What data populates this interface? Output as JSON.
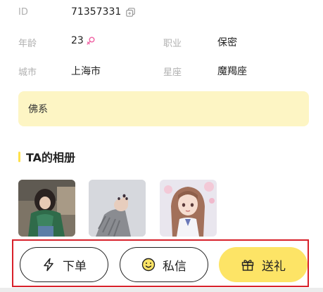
{
  "profile": {
    "id_label": "ID",
    "id_value": "71357331",
    "age_label": "年龄",
    "age_value": "23",
    "job_label": "职业",
    "job_value": "保密",
    "city_label": "城市",
    "city_value": "上海市",
    "zodiac_label": "星座",
    "zodiac_value": "魔羯座",
    "bio": "佛系"
  },
  "album": {
    "title": "TA的相册",
    "photos": [
      "photo-girl-green-sweater",
      "photo-hand-grey-sleeve",
      "photo-anime-girl"
    ]
  },
  "actions": {
    "order_label": "下单",
    "message_label": "私信",
    "gift_label": "送礼"
  },
  "icons": {
    "copy": "copy-icon",
    "gender": "female-icon",
    "order": "lightning-icon",
    "message": "smiley-icon",
    "gift": "gift-icon"
  },
  "colors": {
    "accent_yellow": "#fde466",
    "bio_background": "#fdf5c4",
    "highlight_red": "#d8202a",
    "female_pink": "#f06aa8"
  }
}
